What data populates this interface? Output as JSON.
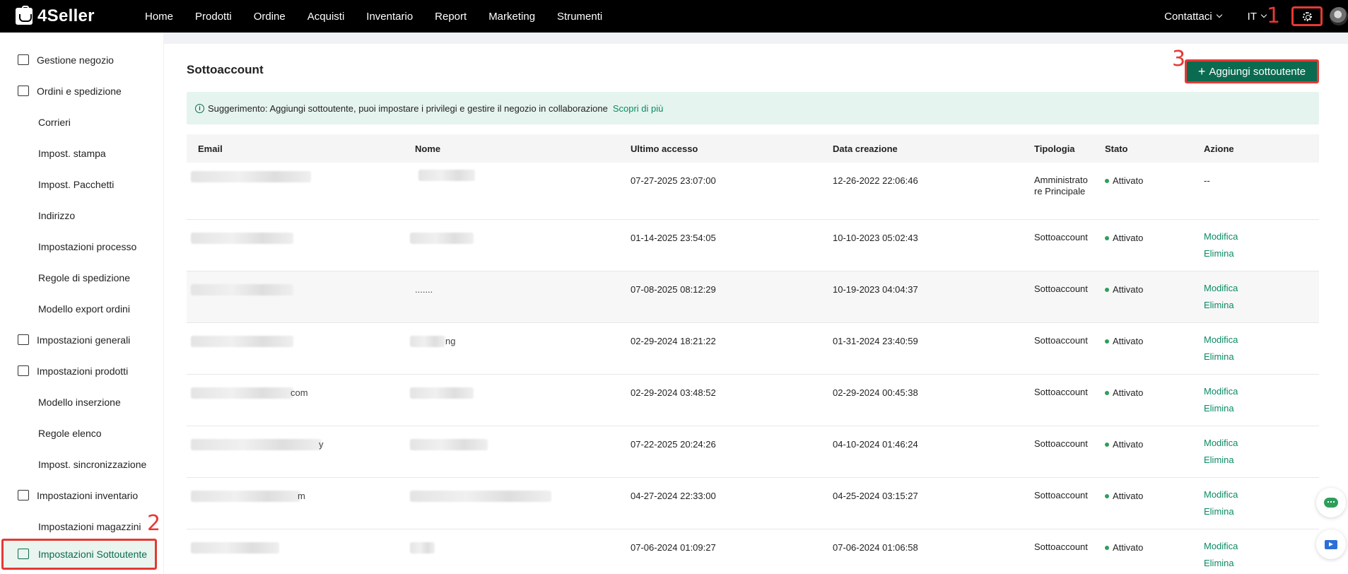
{
  "brand": {
    "name": "4Seller"
  },
  "topnav": [
    "Home",
    "Prodotti",
    "Ordine",
    "Acquisti",
    "Inventario",
    "Report",
    "Marketing",
    "Strumenti"
  ],
  "topright": {
    "contact": "Contattaci",
    "language": "IT"
  },
  "annotations": [
    "1",
    "2",
    "3"
  ],
  "sidebar": {
    "items": [
      {
        "label": "Gestione negozio",
        "level": "parent"
      },
      {
        "label": "Ordini e spedizione",
        "level": "parent"
      },
      {
        "label": "Corrieri",
        "level": "child"
      },
      {
        "label": "Impost. stampa",
        "level": "child"
      },
      {
        "label": "Impost. Pacchetti",
        "level": "child"
      },
      {
        "label": "Indirizzo",
        "level": "child"
      },
      {
        "label": "Impostazioni processo",
        "level": "child"
      },
      {
        "label": "Regole di spedizione",
        "level": "child"
      },
      {
        "label": "Modello export ordini",
        "level": "child"
      },
      {
        "label": "Impostazioni generali",
        "level": "parent"
      },
      {
        "label": "Impostazioni prodotti",
        "level": "parent"
      },
      {
        "label": "Modello inserzione",
        "level": "child"
      },
      {
        "label": "Regole elenco",
        "level": "child"
      },
      {
        "label": "Impost. sincronizzazione",
        "level": "child"
      },
      {
        "label": "Impostazioni inventario",
        "level": "parent"
      },
      {
        "label": "Impostazioni magazzini",
        "level": "child"
      },
      {
        "label": "Impostazioni Sottoutente",
        "level": "parent",
        "active": true
      }
    ]
  },
  "main": {
    "title": "Sottoaccount",
    "add_button": "Aggiungi sottoutente",
    "tip": {
      "text": "Suggerimento: Aggiungi sottoutente, puoi impostare i privilegi e gestire il negozio in collaborazione",
      "link": "Scopri di più"
    }
  },
  "table": {
    "headers": [
      "Email",
      "Nome",
      "Ultimo accesso",
      "Data creazione",
      "Tipologia",
      "Stato",
      "Azione"
    ],
    "rows": [
      {
        "email_suffix": "",
        "name_suffix": "",
        "last_access": "07-27-2025 23:07:00",
        "created": "12-26-2022 22:06:46",
        "type": "Amministratore Principale",
        "status": "Attivato",
        "actions": [
          "--"
        ]
      },
      {
        "email_suffix": "",
        "name_suffix": "",
        "last_access": "01-14-2025 23:54:05",
        "created": "10-10-2023 05:02:43",
        "type": "Sottoaccount",
        "status": "Attivato",
        "actions": [
          "Modifica",
          "Elimina"
        ]
      },
      {
        "email_suffix": "",
        "name_suffix": ".......",
        "last_access": "07-08-2025 08:12:29",
        "created": "10-19-2023 04:04:37",
        "type": "Sottoaccount",
        "status": "Attivato",
        "actions": [
          "Modifica",
          "Elimina"
        ]
      },
      {
        "email_suffix": "",
        "name_suffix": "ng",
        "last_access": "02-29-2024 18:21:22",
        "created": "01-31-2024 23:40:59",
        "type": "Sottoaccount",
        "status": "Attivato",
        "actions": [
          "Modifica",
          "Elimina"
        ]
      },
      {
        "email_suffix": "com",
        "name_suffix": "",
        "last_access": "02-29-2024 03:48:52",
        "created": "02-29-2024 00:45:38",
        "type": "Sottoaccount",
        "status": "Attivato",
        "actions": [
          "Modifica",
          "Elimina"
        ]
      },
      {
        "email_suffix": "y",
        "name_suffix": "",
        "last_access": "07-22-2025 20:24:26",
        "created": "04-10-2024 01:46:24",
        "type": "Sottoaccount",
        "status": "Attivato",
        "actions": [
          "Modifica",
          "Elimina"
        ]
      },
      {
        "email_suffix": "m",
        "name_suffix": "",
        "last_access": "04-27-2024 22:33:00",
        "created": "04-25-2024 03:15:27",
        "type": "Sottoaccount",
        "status": "Attivato",
        "actions": [
          "Modifica",
          "Elimina"
        ]
      },
      {
        "email_suffix": "",
        "name_suffix": "",
        "last_access": "07-06-2024 01:09:27",
        "created": "07-06-2024 01:06:58",
        "type": "Sottoaccount",
        "status": "Attivato",
        "actions": [
          "Modifica",
          "Elimina"
        ]
      }
    ]
  },
  "colors": {
    "accent": "#0b6b50",
    "link": "#0b8a64",
    "annotation": "#e53935",
    "status_active": "#2e9e5b"
  },
  "icons": {
    "settings": "gear-icon",
    "chat": "chat-icon",
    "screen": "screen-share-icon",
    "tip": "info-icon"
  }
}
